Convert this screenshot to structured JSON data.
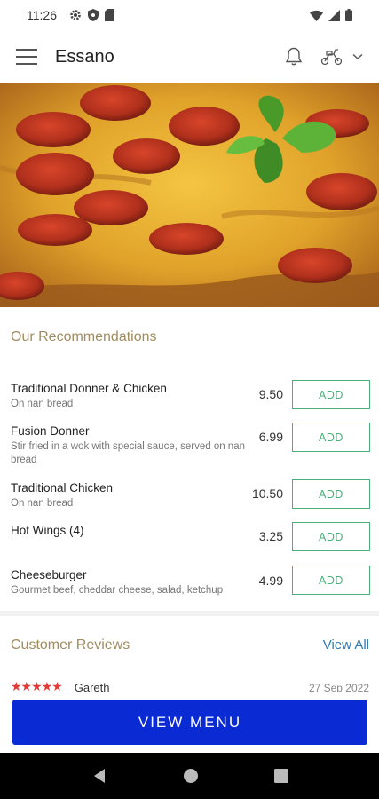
{
  "status_bar": {
    "time": "11:26",
    "left_icons": [
      "gear-icon",
      "shield-icon",
      "sim-card-icon"
    ],
    "right_icons": [
      "wifi-icon",
      "signal-icon",
      "battery-icon"
    ]
  },
  "app_bar": {
    "title": "Essano",
    "icons": [
      "menu-icon",
      "bell-icon",
      "scooter-icon",
      "chevron-down-icon"
    ]
  },
  "hero": {
    "image": "pepperoni pizza with basil"
  },
  "recommendations": {
    "title": "Our Recommendations",
    "items": [
      {
        "name": "Traditional Donner & Chicken",
        "description": "On nan bread",
        "price": "9.50",
        "button": "ADD"
      },
      {
        "name": "Fusion Donner",
        "description": "Stir fried in a wok with special sauce, served on nan bread",
        "price": "6.99",
        "button": "ADD"
      },
      {
        "name": "Traditional Chicken",
        "description": "On nan bread",
        "price": "10.50",
        "button": "ADD"
      },
      {
        "name": "Hot Wings (4)",
        "description": "",
        "price": "3.25",
        "button": "ADD"
      },
      {
        "name": "Cheeseburger",
        "description": "Gourmet beef, cheddar cheese, salad, ketchup",
        "price": "4.99",
        "button": "ADD"
      }
    ]
  },
  "reviews": {
    "title": "Customer Reviews",
    "view_all": "View All",
    "first": {
      "stars": "★★★★★",
      "reviewer": "Gareth",
      "date": "27 Sep 2022"
    }
  },
  "cta": {
    "label": "VIEW MENU"
  },
  "colors": {
    "accent_gold": "#a08c5f",
    "add_green": "#4caf7a",
    "link_blue": "#2a7bb5",
    "cta_blue": "#0a2bd4",
    "star_red": "#e53935"
  }
}
